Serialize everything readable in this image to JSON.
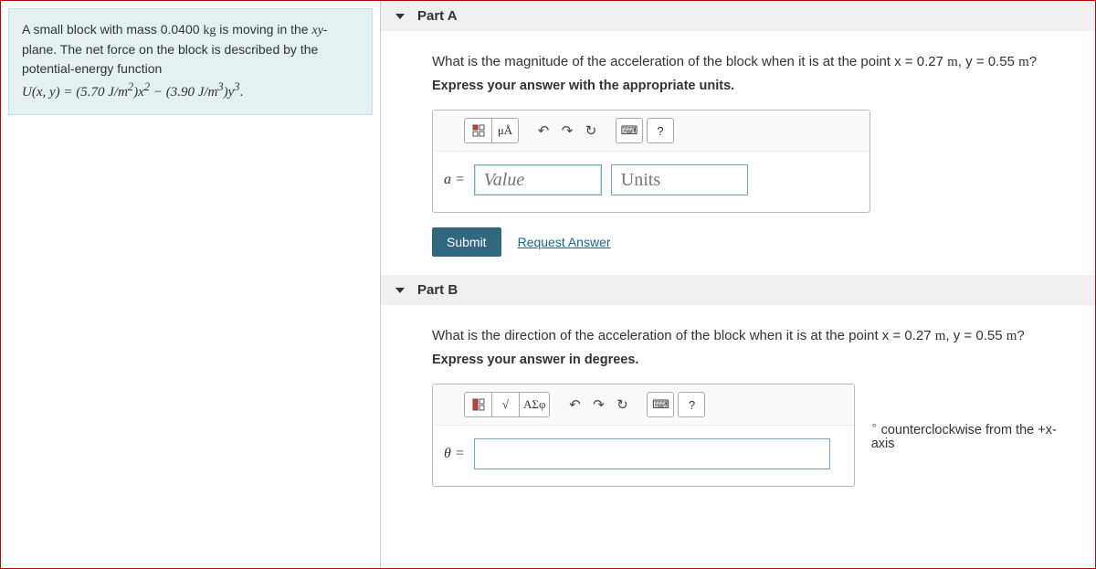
{
  "problem": {
    "text_1": "A small block with mass 0.0400 ",
    "kg": "kg",
    "text_2": " is moving in the ",
    "xy": "xy",
    "text_3": "-plane. The net force on the block is described by the potential-energy function",
    "eq_prefix": "U(x, y) = (5.70 J/m",
    "sup2a": "2",
    "mid1": ")x",
    "sup2b": "2",
    "mid2": " − (3.90 J/m",
    "sup3a": "3",
    "mid3": ")y",
    "sup3b": "3",
    "end": "."
  },
  "partA": {
    "title": "Part A",
    "prompt_prefix": "What is the magnitude of the acceleration of the block when it is at the point ",
    "x_lbl": "x",
    "eq1": " = 0.27 ",
    "m1": "m",
    "sep": ", ",
    "y_lbl": "y",
    "eq2": " = 0.55 ",
    "m2": "m",
    "q": "?",
    "instruct": "Express your answer with the appropriate units.",
    "lhs": "a =",
    "value_ph": "Value",
    "units_ph": "Units",
    "submit": "Submit",
    "request": "Request Answer",
    "tb_units_sym": "μÅ",
    "help": "?"
  },
  "partB": {
    "title": "Part B",
    "prompt_prefix": "What is the direction of the acceleration of the block when it is at the point ",
    "x_lbl": "x",
    "eq1": " = 0.27 ",
    "m1": "m",
    "sep": ", ",
    "y_lbl": "y",
    "eq2": " = 0.55 ",
    "m2": "m",
    "q": "?",
    "instruct": "Express your answer in degrees.",
    "lhs": "θ =",
    "suffix": "counterclockwise from the +x-axis",
    "deg": "∘",
    "tb_sym": "ΑΣφ",
    "help": "?"
  }
}
